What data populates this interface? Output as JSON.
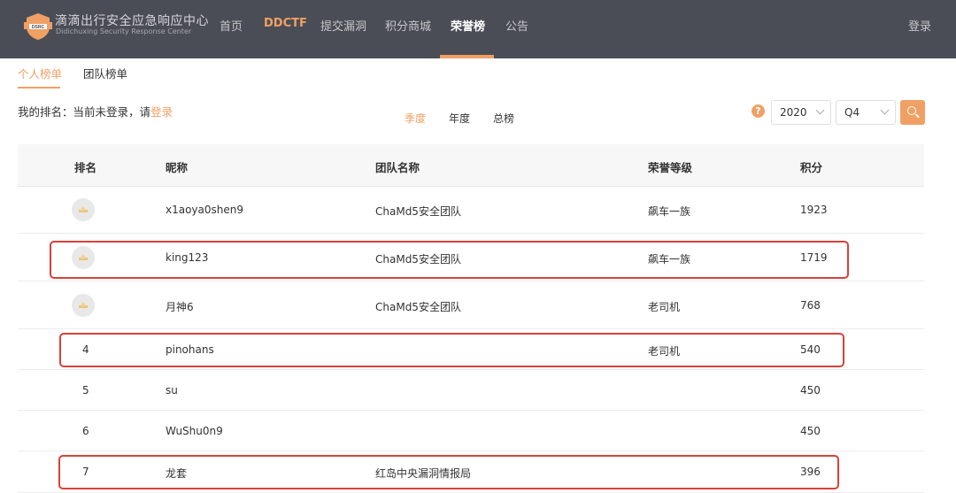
{
  "brand": {
    "title_cn": "滴滴出行安全应急响应中心",
    "title_en": "Didichuxing Security Response Center",
    "logo_text": "DSRC",
    "logo_icon": "shield-logo"
  },
  "nav": {
    "items": [
      {
        "label": "首页"
      },
      {
        "label": "DDCTF"
      },
      {
        "label": "提交漏洞"
      },
      {
        "label": "积分商城"
      },
      {
        "label": "荣誉榜"
      },
      {
        "label": "公告"
      }
    ],
    "active": "荣誉榜",
    "login": "登录"
  },
  "subtabs": {
    "personal": "个人榜单",
    "team": "团队榜单",
    "active": "个人榜单"
  },
  "myrank": {
    "prefix": "我的排名：当前未登录，请",
    "link": "登录"
  },
  "period_tabs": {
    "quarter": "季度",
    "year": "年度",
    "total": "总榜",
    "active": "季度"
  },
  "filters": {
    "help_icon": "question-icon",
    "year": "2020",
    "quarter": "Q4",
    "search_icon": "search-icon"
  },
  "table": {
    "headers": {
      "rank": "排名",
      "nickname": "昵称",
      "team": "团队名称",
      "level": "荣誉等级",
      "points": "积分"
    },
    "rows": [
      {
        "rank": "",
        "medal": "gold",
        "nickname": "x1aoya0shen9",
        "team": "ChaMd5安全团队",
        "level": "飙车一族",
        "points": "1923"
      },
      {
        "rank": "",
        "medal": "silver",
        "nickname": "king123",
        "team": "ChaMd5安全团队",
        "level": "飙车一族",
        "points": "1719"
      },
      {
        "rank": "",
        "medal": "bronze",
        "nickname": "月神6",
        "team": "ChaMd5安全团队",
        "level": "老司机",
        "points": "768"
      },
      {
        "rank": "4",
        "nickname": "pinohans",
        "team": "",
        "level": "老司机",
        "points": "540"
      },
      {
        "rank": "5",
        "nickname": "su",
        "team": "",
        "level": "",
        "points": "450"
      },
      {
        "rank": "6",
        "nickname": "WuShu0n9",
        "team": "",
        "level": "",
        "points": "450"
      },
      {
        "rank": "7",
        "nickname": "龙套",
        "team": "红岛中央漏洞情报局",
        "level": "",
        "points": "396"
      }
    ]
  },
  "colors": {
    "nav_bg": "#4a4d56",
    "accent": "#f0a064",
    "highlight": "#d8413a"
  }
}
